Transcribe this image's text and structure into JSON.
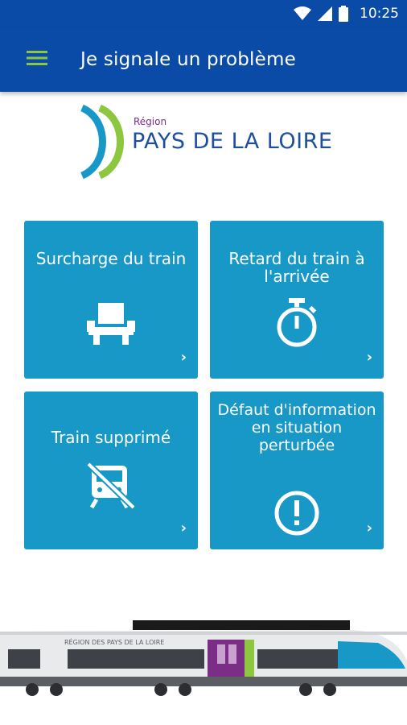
{
  "status_bar": {
    "time": "10:25",
    "icons": [
      "wifi-icon",
      "signal-icon",
      "battery-icon"
    ]
  },
  "app_bar": {
    "title": "Je signale un problème",
    "menu_icon": "hamburger-menu-icon"
  },
  "logo": {
    "region": "Région",
    "name": "PAYS DE LA LOIRE"
  },
  "tiles": [
    {
      "label": "Surcharge du train",
      "icon": "seat-icon"
    },
    {
      "label": "Retard du train à l'arrivée",
      "icon": "stopwatch-icon"
    },
    {
      "label": "Train supprimé",
      "icon": "train-off-icon"
    },
    {
      "label": "Défaut d'information en situation perturbée",
      "icon": "exclamation-circle-icon"
    }
  ],
  "train": {
    "livery_text": "RÉGION DES PAYS DE LA LOIRE"
  },
  "colors": {
    "primary": "#0A4BA8",
    "tile": "#1898C7",
    "accent_menu": "#8DC63F",
    "logo_blue": "#1E4F9E",
    "logo_green": "#8DC63F",
    "logo_purple": "#7A2E86"
  }
}
